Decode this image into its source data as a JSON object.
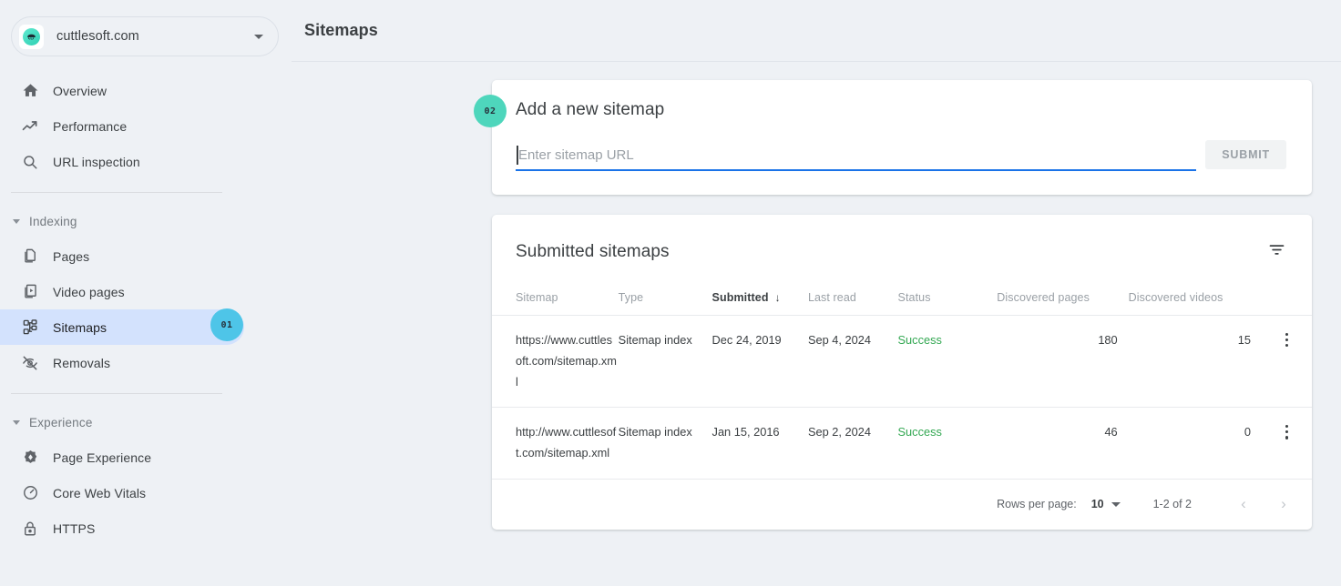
{
  "sidebar": {
    "site_selector": {
      "name": "cuttlesoft.com",
      "logo_icon": "cuttlefish-logo-icon",
      "caret_icon": "chevron-down-icon"
    },
    "primary_items": [
      {
        "label": "Overview",
        "icon": "home-icon"
      },
      {
        "label": "Performance",
        "icon": "trending-up-icon"
      },
      {
        "label": "URL inspection",
        "icon": "search-icon"
      }
    ],
    "sections": [
      {
        "label": "Indexing",
        "collapse_icon": "triangle-down-icon",
        "items": [
          {
            "label": "Pages",
            "icon": "pages-copy-icon",
            "active": false
          },
          {
            "label": "Video pages",
            "icon": "video-pages-icon",
            "active": false
          },
          {
            "label": "Sitemaps",
            "icon": "account-tree-icon",
            "active": true
          },
          {
            "label": "Removals",
            "icon": "eye-off-icon",
            "active": false
          }
        ]
      },
      {
        "label": "Experience",
        "collapse_icon": "triangle-down-icon",
        "items": [
          {
            "label": "Page Experience",
            "icon": "page-experience-icon",
            "active": false
          },
          {
            "label": "Core Web Vitals",
            "icon": "speedometer-icon",
            "active": false
          },
          {
            "label": "HTTPS",
            "icon": "lock-icon",
            "active": false
          }
        ]
      }
    ]
  },
  "header": {
    "title": "Sitemaps"
  },
  "badges": [
    {
      "id": "01",
      "label": "01",
      "color": "#4ec5e8",
      "target": "sidebar-item-sitemaps"
    },
    {
      "id": "02",
      "label": "02",
      "color": "#4ed6bc",
      "target": "add-sitemap-card"
    }
  ],
  "add_sitemap": {
    "title": "Add a new sitemap",
    "input_value": "",
    "input_placeholder": "Enter sitemap URL",
    "submit_label": "SUBMIT",
    "submit_disabled": true,
    "focus_color": "#1a73e8"
  },
  "submitted_sitemaps": {
    "title": "Submitted sitemaps",
    "filter_icon": "filter-list-icon",
    "columns": [
      {
        "key": "sitemap",
        "label": "Sitemap"
      },
      {
        "key": "type",
        "label": "Type"
      },
      {
        "key": "submitted",
        "label": "Submitted",
        "sorted": true,
        "sort_dir": "desc",
        "sort_icon": "arrow-down-icon"
      },
      {
        "key": "last_read",
        "label": "Last read"
      },
      {
        "key": "status",
        "label": "Status"
      },
      {
        "key": "discovered_pages",
        "label": "Discovered pages"
      },
      {
        "key": "discovered_videos",
        "label": "Discovered videos"
      }
    ],
    "rows": [
      {
        "sitemap": "https://www.cuttlesoft.com/sitemap.xml",
        "type": "Sitemap index",
        "submitted": "Dec 24, 2019",
        "last_read": "Sep 4, 2024",
        "status": "Success",
        "status_color": "#34a853",
        "discovered_pages": "180",
        "discovered_videos": "15",
        "menu_icon": "more-vert-icon"
      },
      {
        "sitemap": "http://www.cuttlesoft.com/sitemap.xml",
        "type": "Sitemap index",
        "submitted": "Jan 15, 2016",
        "last_read": "Sep 2, 2024",
        "status": "Success",
        "status_color": "#34a853",
        "discovered_pages": "46",
        "discovered_videos": "0",
        "menu_icon": "more-vert-icon"
      }
    ],
    "footer": {
      "rows_per_page_label": "Rows per page:",
      "rows_per_page_value": "10",
      "rows_per_page_caret": "chevron-down-icon",
      "range_text": "1-2 of 2",
      "prev_icon": "chevron-left-icon",
      "next_icon": "chevron-right-icon",
      "prev_disabled": true,
      "next_disabled": true
    }
  }
}
